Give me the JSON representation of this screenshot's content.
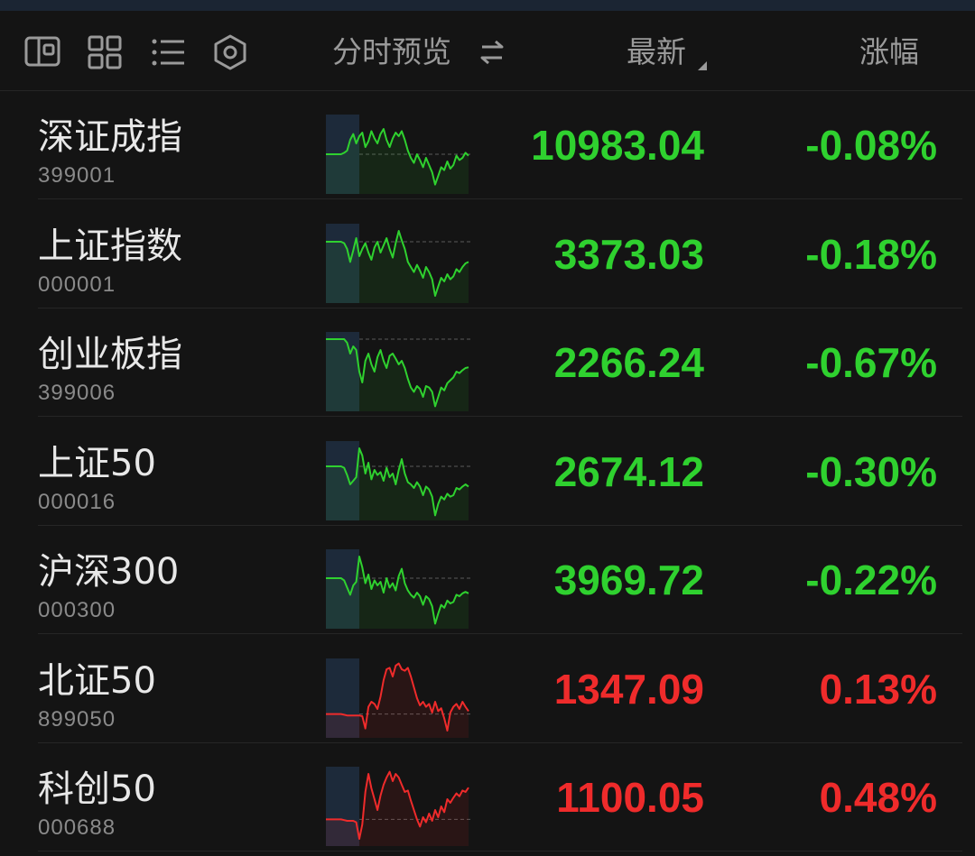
{
  "header": {
    "icons": [
      "layout-split-icon",
      "grid-icon",
      "list-icon",
      "settings-hex-icon"
    ],
    "col_preview": "分时预览",
    "col_latest": "最新",
    "col_change": "涨幅"
  },
  "colors": {
    "down": "#2fd12f",
    "up": "#ef2b2b",
    "prev_close_panel": "#1d2a3a"
  },
  "rows": [
    {
      "name": "深证成指",
      "code": "399001",
      "price": "10983.04",
      "change": "-0.08%",
      "dir": "down",
      "trend": [
        0.5,
        0.5,
        0.5,
        0.5,
        0.5,
        0.5,
        0.48,
        0.45,
        0.3,
        0.22,
        0.35,
        0.25,
        0.2,
        0.4,
        0.32,
        0.18,
        0.28,
        0.35,
        0.22,
        0.15,
        0.3,
        0.4,
        0.28,
        0.2,
        0.25,
        0.18,
        0.3,
        0.45,
        0.55,
        0.62,
        0.5,
        0.58,
        0.68,
        0.55,
        0.65,
        0.75,
        0.92,
        0.8,
        0.68,
        0.72,
        0.6,
        0.7,
        0.65,
        0.52,
        0.58,
        0.55,
        0.48,
        0.52
      ]
    },
    {
      "name": "上证指数",
      "code": "000001",
      "price": "3373.03",
      "change": "-0.18%",
      "dir": "down",
      "trend": [
        0.2,
        0.2,
        0.2,
        0.2,
        0.2,
        0.2,
        0.22,
        0.3,
        0.48,
        0.32,
        0.15,
        0.4,
        0.3,
        0.22,
        0.35,
        0.45,
        0.28,
        0.2,
        0.35,
        0.25,
        0.15,
        0.3,
        0.42,
        0.22,
        0.05,
        0.18,
        0.3,
        0.48,
        0.55,
        0.62,
        0.52,
        0.6,
        0.7,
        0.55,
        0.62,
        0.72,
        0.95,
        0.82,
        0.7,
        0.75,
        0.65,
        0.72,
        0.68,
        0.58,
        0.62,
        0.55,
        0.5,
        0.48
      ]
    },
    {
      "name": "创业板指",
      "code": "399006",
      "price": "2266.24",
      "change": "-0.67%",
      "dir": "down",
      "trend": [
        0.05,
        0.05,
        0.05,
        0.05,
        0.05,
        0.05,
        0.05,
        0.1,
        0.25,
        0.15,
        0.2,
        0.5,
        0.65,
        0.35,
        0.25,
        0.4,
        0.5,
        0.3,
        0.2,
        0.35,
        0.45,
        0.28,
        0.25,
        0.32,
        0.4,
        0.35,
        0.45,
        0.6,
        0.72,
        0.78,
        0.7,
        0.74,
        0.85,
        0.7,
        0.72,
        0.78,
        0.98,
        0.85,
        0.72,
        0.76,
        0.66,
        0.62,
        0.58,
        0.5,
        0.52,
        0.48,
        0.45,
        0.44
      ]
    },
    {
      "name": "上证50",
      "code": "000016",
      "price": "2674.12",
      "change": "-0.30%",
      "dir": "down",
      "trend": [
        0.3,
        0.3,
        0.3,
        0.3,
        0.3,
        0.3,
        0.32,
        0.42,
        0.55,
        0.5,
        0.45,
        0.05,
        0.15,
        0.4,
        0.25,
        0.48,
        0.35,
        0.42,
        0.38,
        0.5,
        0.32,
        0.45,
        0.4,
        0.55,
        0.35,
        0.2,
        0.4,
        0.52,
        0.55,
        0.6,
        0.52,
        0.58,
        0.7,
        0.58,
        0.62,
        0.72,
        0.98,
        0.82,
        0.72,
        0.76,
        0.68,
        0.72,
        0.7,
        0.6,
        0.62,
        0.58,
        0.55,
        0.58
      ]
    },
    {
      "name": "沪深300",
      "code": "000300",
      "price": "3969.72",
      "change": "-0.22%",
      "dir": "down",
      "trend": [
        0.35,
        0.35,
        0.35,
        0.35,
        0.35,
        0.35,
        0.38,
        0.48,
        0.58,
        0.45,
        0.4,
        0.05,
        0.2,
        0.42,
        0.3,
        0.5,
        0.38,
        0.45,
        0.4,
        0.55,
        0.35,
        0.48,
        0.42,
        0.52,
        0.32,
        0.22,
        0.42,
        0.52,
        0.58,
        0.62,
        0.55,
        0.6,
        0.72,
        0.6,
        0.64,
        0.74,
        0.98,
        0.84,
        0.72,
        0.76,
        0.66,
        0.7,
        0.68,
        0.58,
        0.6,
        0.56,
        0.54,
        0.56
      ]
    },
    {
      "name": "北证50",
      "code": "899050",
      "price": "1347.09",
      "change": "0.13%",
      "dir": "up",
      "trend": [
        0.72,
        0.72,
        0.72,
        0.72,
        0.72,
        0.72,
        0.73,
        0.74,
        0.74,
        0.74,
        0.74,
        0.74,
        0.75,
        0.92,
        0.62,
        0.55,
        0.58,
        0.65,
        0.48,
        0.25,
        0.1,
        0.08,
        0.2,
        0.05,
        0.02,
        0.1,
        0.12,
        0.08,
        0.2,
        0.35,
        0.5,
        0.6,
        0.55,
        0.62,
        0.58,
        0.7,
        0.55,
        0.68,
        0.64,
        0.78,
        0.95,
        0.7,
        0.62,
        0.58,
        0.65,
        0.55,
        0.62,
        0.68
      ]
    },
    {
      "name": "科创50",
      "code": "000688",
      "price": "1100.05",
      "change": "0.48%",
      "dir": "up",
      "trend": [
        0.68,
        0.68,
        0.68,
        0.68,
        0.68,
        0.68,
        0.69,
        0.7,
        0.7,
        0.7,
        0.72,
        0.95,
        0.75,
        0.3,
        0.05,
        0.25,
        0.4,
        0.55,
        0.35,
        0.2,
        0.1,
        0.02,
        0.15,
        0.05,
        0.1,
        0.2,
        0.3,
        0.28,
        0.42,
        0.55,
        0.68,
        0.78,
        0.65,
        0.72,
        0.6,
        0.7,
        0.55,
        0.65,
        0.5,
        0.58,
        0.4,
        0.45,
        0.38,
        0.32,
        0.36,
        0.28,
        0.3,
        0.24
      ]
    }
  ]
}
